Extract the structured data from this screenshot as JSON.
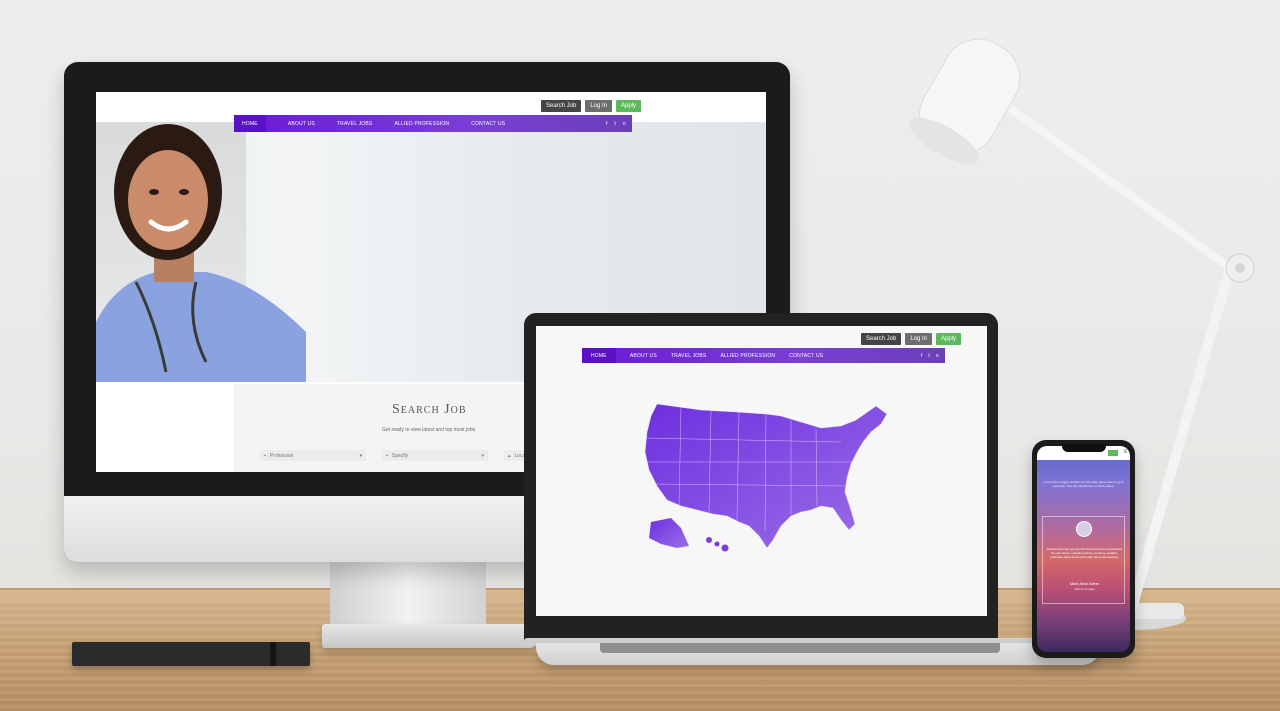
{
  "monitor_site": {
    "top_buttons": [
      "Search Job",
      "Log In",
      "Apply"
    ],
    "nav": [
      "HOME",
      "ABOUT US",
      "TRAVEL JOBS",
      "ALLIED PROFESSION",
      "CONTACT US"
    ],
    "social": [
      "f",
      "t",
      "o"
    ],
    "search_title": "Search Job",
    "search_subtitle": "Get ready to view latest and top most jobs",
    "fields": [
      "Profession",
      "Specify",
      "Location"
    ]
  },
  "laptop_site": {
    "top_buttons": [
      "Search Job",
      "Log In",
      "Apply"
    ],
    "nav": [
      "HOME",
      "ABOUT US",
      "TRAVEL JOBS",
      "ALLIED PROFESSION",
      "CONTACT US"
    ],
    "social": [
      "f",
      "t",
      "o"
    ]
  },
  "phone_site": {
    "intro": "A cool has a bigger problem so that other game sees in your expertise. Now the introduction of more Game.",
    "quote": "Accessories help you get the finest concours accessories for your horse, maintain primes, ocariney, saddles, protective horse boots and other horse accessories.",
    "author": "Mark Alvin Allero",
    "role": "CEO at Google"
  },
  "colors": {
    "nav_purple": "#6a19d6",
    "map_purple": "#7b3be0",
    "apply_green": "#5cb85c"
  }
}
